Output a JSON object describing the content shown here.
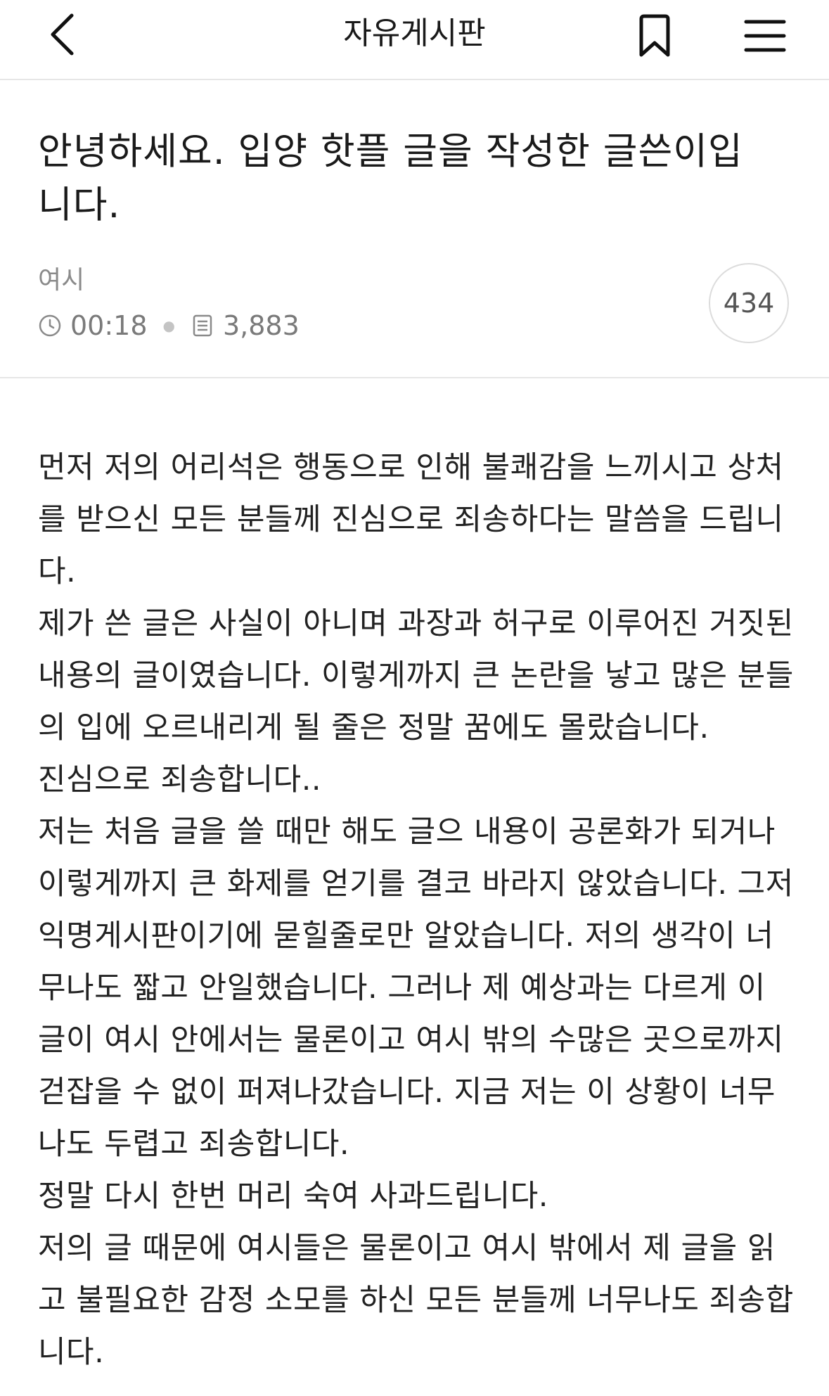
{
  "header": {
    "back_icon": "chevron-left-icon",
    "title": "자유게시판",
    "bookmark_icon": "bookmark-icon",
    "menu_icon": "hamburger-menu-icon"
  },
  "post": {
    "title": "안녕하세요. 입양 핫플 글을 작성한 글쓴이입니다.",
    "author": "여시",
    "time": "00:18",
    "views": "3,883",
    "comment_count": "434",
    "body": [
      "먼저 저의 어리석은 행동으로 인해 불쾌감을 느끼시고 상처를 받으신 모든 분들께 진심으로 죄송하다는 말씀을 드립니다.",
      "제가 쓴 글은 사실이 아니며 과장과 허구로 이루어진 거짓된 내용의 글이였습니다. 이렇게까지 큰 논란을 낳고 많은 분들의 입에 오르내리게 될 줄은 정말 꿈에도 몰랐습니다.",
      "진심으로 죄송합니다..",
      "저는 처음 글을 쓸 때만 해도 글으 내용이 공론화가 되거나 이렇게까지 큰 화제를 얻기를 결코 바라지 않았습니다. 그저 익명게시판이기에 묻힐줄로만 알았습니다. 저의 생각이 너무나도 짧고 안일했습니다. 그러나 제 예상과는 다르게 이 글이 여시 안에서는 물론이고 여시 밖의 수많은 곳으로까지 걷잡을 수 없이 퍼져나갔습니다. 지금 저는 이 상황이 너무나도 두렵고 죄송합니다.",
      "정말 다시 한번 머리 숙여 사과드립니다.",
      "저의 글 때문에 여시들은 물론이고 여시 밖에서 제 글을 읽고 불필요한 감정 소모를 하신 모든 분들께 너무나도 죄송합니다."
    ]
  },
  "icons": {
    "time": "clock-icon",
    "views": "document-icon"
  },
  "colors": {
    "text": "#1a1a1a",
    "meta": "#7a7a7a",
    "divider": "#e6e6e6"
  }
}
